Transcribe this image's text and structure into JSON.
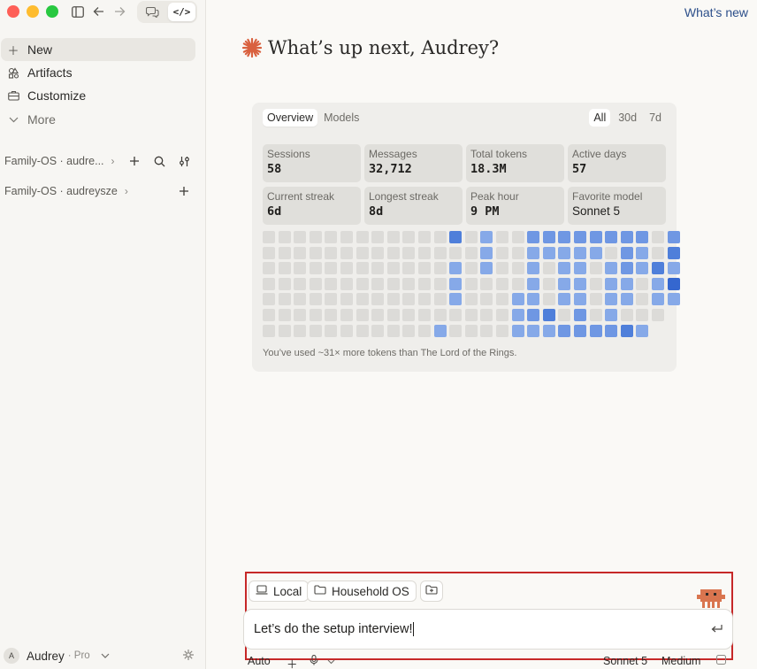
{
  "window": {
    "whats_new": "What’s new"
  },
  "toolbar": {
    "sidebar_toggle_icon": "sidebar-icon",
    "back_icon": "arrow-left-icon",
    "forward_icon": "arrow-right-icon",
    "chat_icon": "chat-icon",
    "code_icon": "code-icon",
    "code_label": "</>"
  },
  "sidebar": {
    "nav": [
      {
        "label": "New",
        "icon": "plus-icon"
      },
      {
        "label": "Artifacts",
        "icon": "artifacts-icon"
      },
      {
        "label": "Customize",
        "icon": "briefcase-icon"
      },
      {
        "label": "More",
        "icon": "chevron-down-icon"
      }
    ],
    "projects": [
      {
        "label": "Family-OS · audre..."
      },
      {
        "label": "Family-OS · audreysze"
      }
    ],
    "user": {
      "initial": "A",
      "name": "Audrey",
      "plan": "· Pro"
    }
  },
  "main": {
    "greeting": "What’s up next, Audrey?",
    "stats": {
      "tabs": [
        "Overview",
        "Models"
      ],
      "ranges": [
        "All",
        "30d",
        "7d"
      ],
      "cards": [
        {
          "label": "Sessions",
          "value": "58"
        },
        {
          "label": "Messages",
          "value": "32,712"
        },
        {
          "label": "Total tokens",
          "value": "18.3M"
        },
        {
          "label": "Active days",
          "value": "57"
        },
        {
          "label": "Current streak",
          "value": "6d"
        },
        {
          "label": "Longest streak",
          "value": "8d"
        },
        {
          "label": "Peak hour",
          "value": "9 PM"
        },
        {
          "label": "Favorite model",
          "value": "Sonnet 5"
        }
      ],
      "heatmap_levels": [
        [
          0,
          0,
          0,
          0,
          0,
          0,
          0,
          0,
          0,
          0,
          0,
          0,
          3,
          0,
          1,
          0,
          0,
          2,
          2,
          2,
          2,
          2,
          2,
          2,
          2,
          0,
          2
        ],
        [
          0,
          0,
          0,
          0,
          0,
          0,
          0,
          0,
          0,
          0,
          0,
          0,
          0,
          0,
          1,
          0,
          0,
          1,
          1,
          1,
          1,
          1,
          0,
          2,
          1,
          0,
          3
        ],
        [
          0,
          0,
          0,
          0,
          0,
          0,
          0,
          0,
          0,
          0,
          0,
          0,
          1,
          0,
          1,
          0,
          0,
          1,
          0,
          1,
          1,
          0,
          1,
          2,
          1,
          3,
          1
        ],
        [
          0,
          0,
          0,
          0,
          0,
          0,
          0,
          0,
          0,
          0,
          0,
          0,
          1,
          0,
          0,
          0,
          0,
          1,
          0,
          1,
          1,
          0,
          1,
          1,
          0,
          1,
          4
        ],
        [
          0,
          0,
          0,
          0,
          0,
          0,
          0,
          0,
          0,
          0,
          0,
          0,
          1,
          0,
          0,
          0,
          1,
          1,
          0,
          1,
          1,
          0,
          1,
          1,
          0,
          1,
          1
        ],
        [
          0,
          0,
          0,
          0,
          0,
          0,
          0,
          0,
          0,
          0,
          0,
          0,
          0,
          0,
          0,
          0,
          1,
          2,
          3,
          0,
          2,
          0,
          1,
          0,
          0,
          0
        ],
        [
          0,
          0,
          0,
          0,
          0,
          0,
          0,
          0,
          0,
          0,
          0,
          1,
          0,
          0,
          0,
          0,
          1,
          1,
          1,
          2,
          2,
          2,
          2,
          3,
          1
        ]
      ],
      "heatmap_colors": [
        "#dcdbd8",
        "#86a9e8",
        "#6f97e3",
        "#4f7fda",
        "#3567cf"
      ],
      "footnote": "You’ve used ~31× more tokens than The Lord of the Rings."
    }
  },
  "composer": {
    "chips": [
      {
        "label": "Local",
        "icon": "laptop-icon"
      },
      {
        "label": "Household OS",
        "icon": "folder-icon"
      },
      {
        "label": "",
        "icon": "folder-plus-icon"
      }
    ],
    "input_value": "Let’s do the setup interview!",
    "enter_icon": "enter-icon",
    "footer": {
      "mode": "Auto",
      "model": "Sonnet 5",
      "effort": "Medium"
    }
  },
  "colors": {
    "accent_greeting": "#d9613f",
    "highlight_border": "#c62828",
    "link": "#2c4f8a"
  }
}
